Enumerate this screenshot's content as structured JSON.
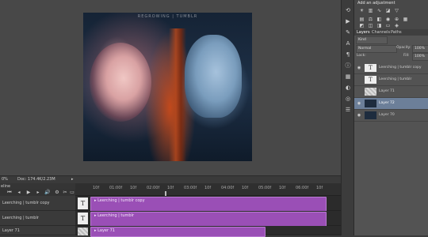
{
  "canvas": {
    "caption": "REGROWING | TUMBLR"
  },
  "status": {
    "zoom": "0%",
    "doc_info": "Doc: 174.4K/2.23M",
    "arrow": "▸"
  },
  "timeline": {
    "title": "eline",
    "ruler": [
      "10f",
      "01:00f",
      "10f",
      "02:00f",
      "10f",
      "03:00f",
      "10f",
      "04:00f",
      "10f",
      "05:00f",
      "10f",
      "06:00f",
      "10f"
    ],
    "controls": [
      "⏮",
      "◂",
      "▶",
      "▸",
      "🔊",
      "⚙",
      "✂",
      "▭"
    ],
    "tracks": [
      {
        "label": "Leerching | tumblr copy",
        "clip": "▸ Leerching | tumblr copy",
        "thumb": "T"
      },
      {
        "label": "Leerching | tumblr",
        "clip": "▸ Leerching | tumblr",
        "thumb": "T"
      },
      {
        "label": "Layer 71",
        "clip": "▸ Layer 71",
        "thumb": ""
      }
    ]
  },
  "swatches_title": "Add an adjustment",
  "layers_panel": {
    "tabs": [
      "Layers",
      "Channels",
      "Paths"
    ],
    "kind": "Kind",
    "blend": "Normal",
    "opacity_label": "Opacity:",
    "opacity": "100%",
    "lock_label": "Lock:",
    "fill_label": "Fill:",
    "fill": "100%",
    "layers": [
      {
        "name": "Leerching | tumblr copy",
        "thumb": "T",
        "visible": true
      },
      {
        "name": "Leerching | tumblr",
        "thumb": "T",
        "visible": false
      },
      {
        "name": "Layer 71",
        "thumb": "",
        "visible": false
      },
      {
        "name": "Layer 72",
        "thumb": "",
        "visible": true
      },
      {
        "name": "Layer 70",
        "thumb": "",
        "visible": true
      }
    ]
  }
}
